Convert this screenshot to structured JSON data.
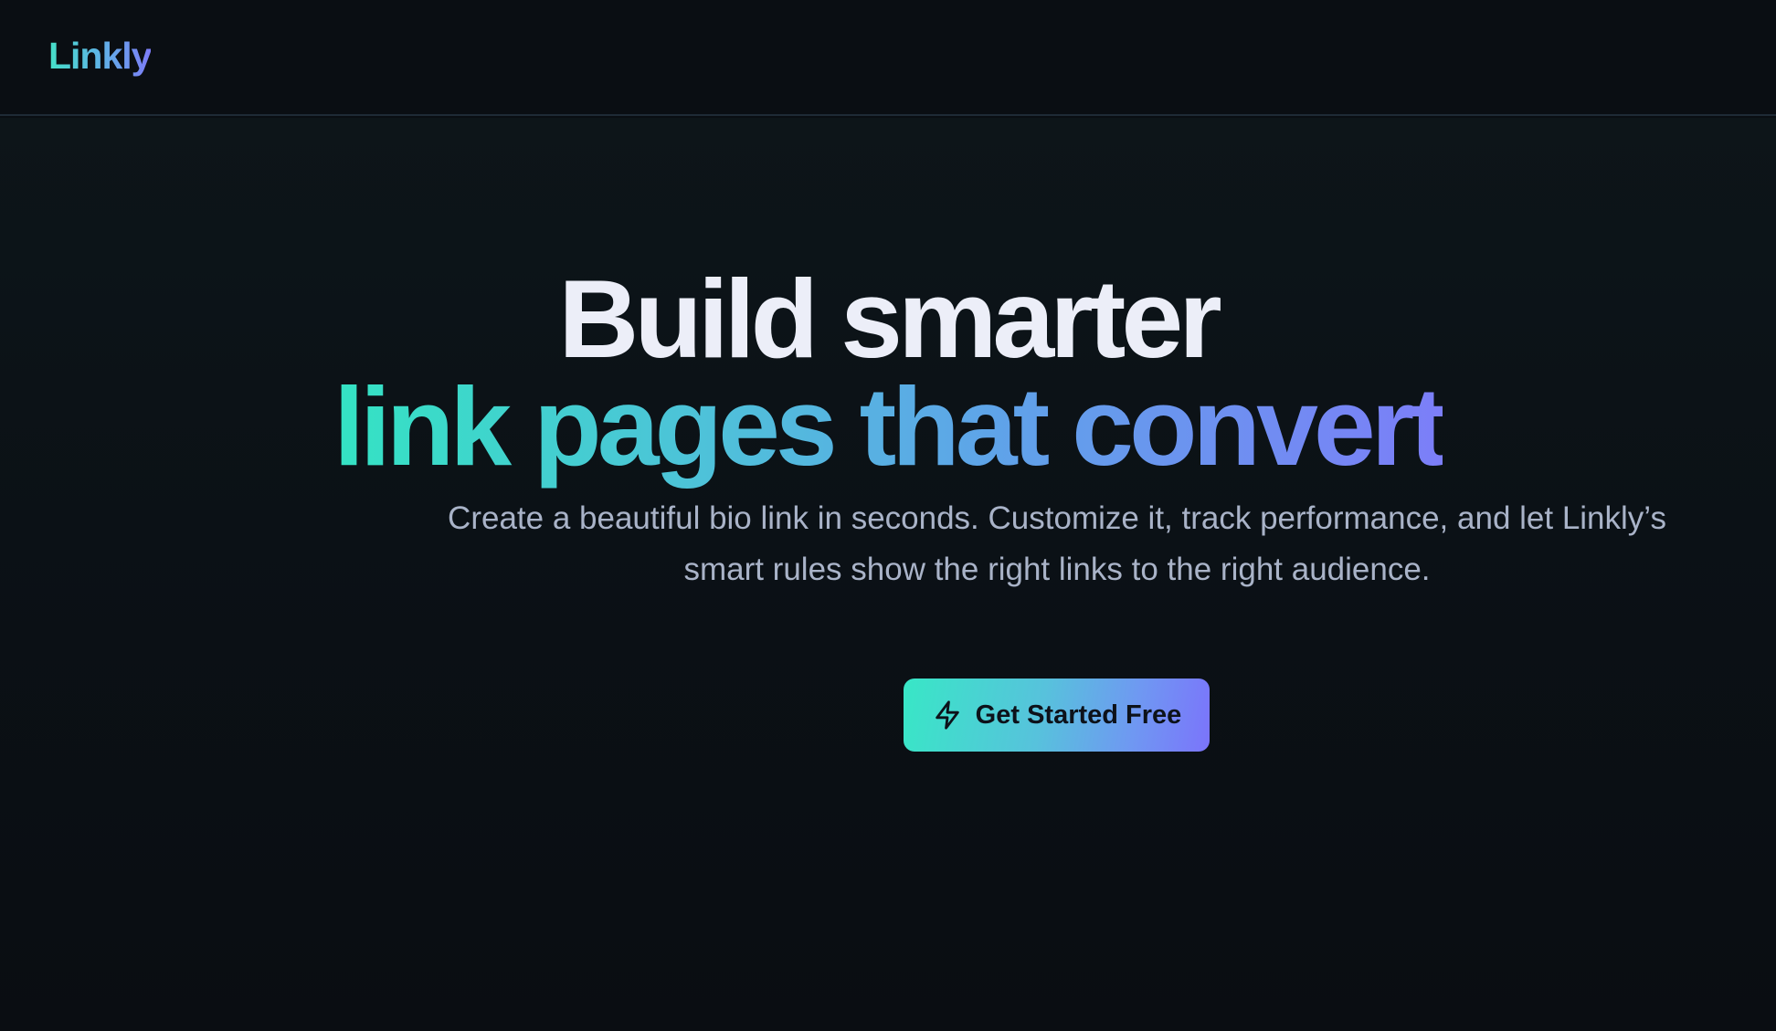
{
  "header": {
    "logo_text": "Linkly"
  },
  "hero": {
    "headline_line1": "Build smarter",
    "headline_line2": "link pages that convert",
    "subtext": "Create a beautiful bio link in seconds. Customize it, track performance, and let Linkly’s smart rules show the right links to the right audience.",
    "cta_label": "Get Started Free",
    "cta_icon": "lightning-bolt-icon"
  },
  "colors": {
    "background": "#0a0e13",
    "headline_white": "#eceef8",
    "gradient_start": "#34e3c3",
    "gradient_end": "#7c7ef8",
    "subtext": "#a9b3c8"
  }
}
